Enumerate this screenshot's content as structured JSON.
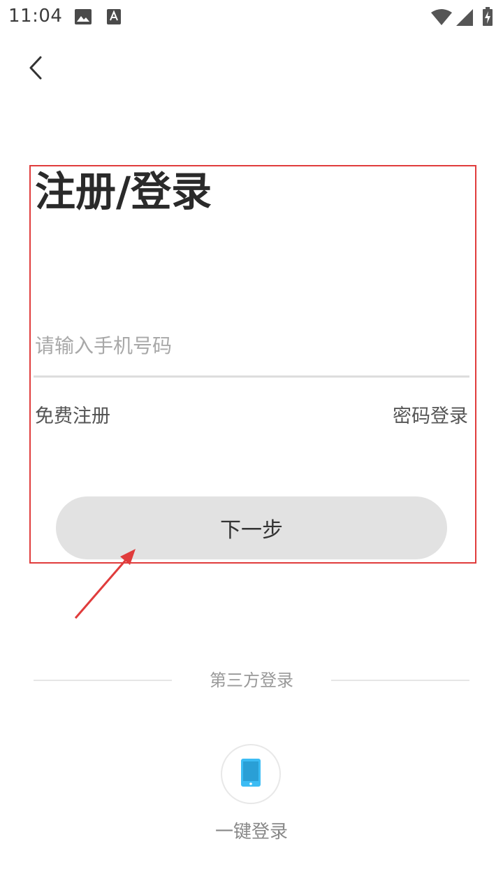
{
  "status_bar": {
    "time": "11:04",
    "icons": [
      "image-icon",
      "a-icon",
      "wifi-icon",
      "signal-icon",
      "battery-charging-icon"
    ]
  },
  "header": {
    "back_icon": "chevron-left-icon"
  },
  "login_form": {
    "title": "注册/登录",
    "phone_input": {
      "value": "",
      "placeholder": "请输入手机号码"
    },
    "free_register_label": "免费注册",
    "password_login_label": "密码登录",
    "next_button_label": "下一步"
  },
  "third_party": {
    "section_label": "第三方登录",
    "one_click_icon": "mobile-phone-icon",
    "one_click_label": "一键登录"
  },
  "colors": {
    "annotation_red": "#e03c3c",
    "button_bg": "#e2e2e2",
    "phone_icon_blue": "#3cbcf4"
  }
}
